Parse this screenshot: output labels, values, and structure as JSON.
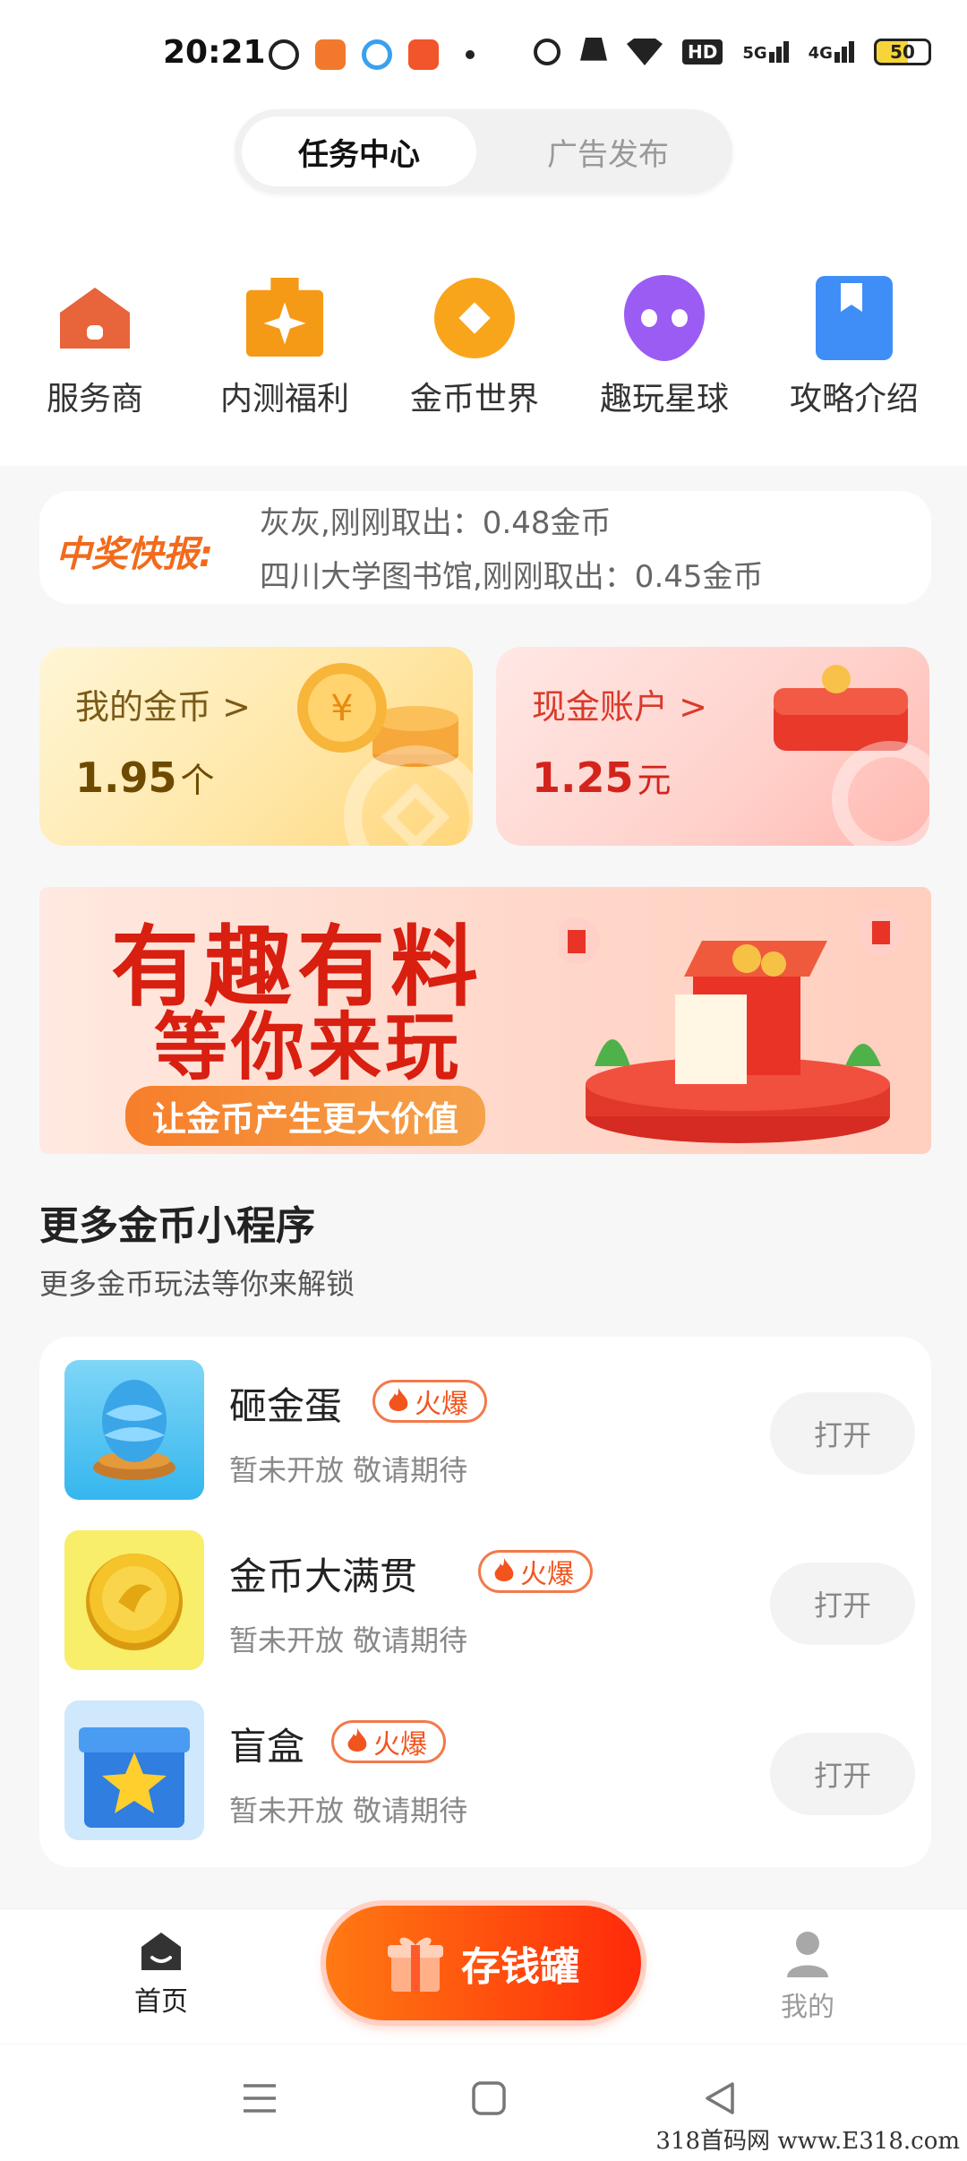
{
  "status_bar": {
    "time": "20:21",
    "battery": "50",
    "network_1": "5G",
    "network_2": "4G",
    "hd": "HD"
  },
  "tabs": {
    "task_center": "任务中心",
    "ad_publish": "广告发布"
  },
  "quick_nav": [
    {
      "label": "服务商",
      "icon": "house-icon",
      "color": "#e8643a"
    },
    {
      "label": "内测福利",
      "icon": "gift-sparkle-icon",
      "color": "#f59a16"
    },
    {
      "label": "金币世界",
      "icon": "coin-diamond-icon",
      "color": "#f9a51b"
    },
    {
      "label": "趣玩星球",
      "icon": "alien-icon",
      "color": "#9b5cf3"
    },
    {
      "label": "攻略介绍",
      "icon": "bookmark-icon",
      "color": "#3f8ef7"
    }
  ],
  "ticker": {
    "label": "中奖快报:",
    "line1": "灰灰,刚刚取出：0.48金币",
    "line2": "四川大学图书馆,刚刚取出：0.45金币"
  },
  "coin_card": {
    "title": "我的金币 >",
    "value": "1.95",
    "unit": "个"
  },
  "cash_card": {
    "title": "现金账户 >",
    "value": "1.25",
    "unit": "元"
  },
  "banner": {
    "line1": "有趣有料",
    "line2": "等你来玩",
    "pill": "让金币产生更大价值"
  },
  "section": {
    "title": "更多金币小程序",
    "subtitle": "更多金币玩法等你来解锁"
  },
  "mini_programs": [
    {
      "name": "砸金蛋",
      "badge": "火爆",
      "status": "暂未开放 敬请期待",
      "button": "打开"
    },
    {
      "name": "金币大满贯",
      "badge": "火爆",
      "status": "暂未开放 敬请期待",
      "button": "打开"
    },
    {
      "name": "盲盒",
      "badge": "火爆",
      "status": "暂未开放 敬请期待",
      "button": "打开"
    }
  ],
  "bottom_nav": {
    "home": "首页",
    "save": "存钱罐",
    "me": "我的"
  },
  "watermark": "318首码网 www.E318.com"
}
